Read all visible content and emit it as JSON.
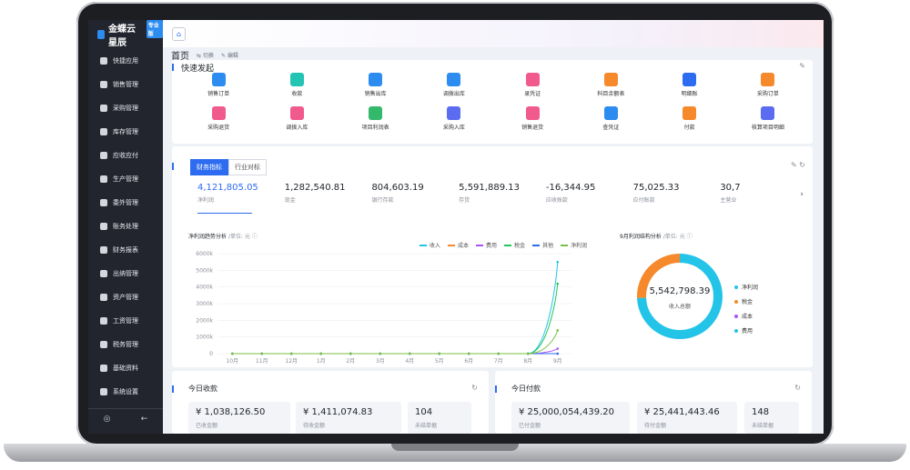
{
  "app": {
    "logo_text": "金蝶云星辰",
    "edition_badge": "专业版"
  },
  "sidebar": {
    "items": [
      {
        "label": "快捷应用",
        "icon": "grid-icon"
      },
      {
        "label": "销售管理",
        "icon": "chart-icon"
      },
      {
        "label": "采购管理",
        "icon": "cart-icon"
      },
      {
        "label": "库存管理",
        "icon": "box-icon"
      },
      {
        "label": "应收应付",
        "icon": "money-icon"
      },
      {
        "label": "生产管理",
        "icon": "factory-icon"
      },
      {
        "label": "委外管理",
        "icon": "outsource-icon"
      },
      {
        "label": "账务处理",
        "icon": "ledger-icon"
      },
      {
        "label": "财务报表",
        "icon": "report-icon"
      },
      {
        "label": "出纳管理",
        "icon": "cashier-icon"
      },
      {
        "label": "资产管理",
        "icon": "asset-icon"
      },
      {
        "label": "工资管理",
        "icon": "salary-icon"
      },
      {
        "label": "税务管理",
        "icon": "tax-icon"
      },
      {
        "label": "基础资料",
        "icon": "data-icon"
      },
      {
        "label": "系统设置",
        "icon": "settings-icon"
      }
    ],
    "footer": {
      "settings_glyph": "◎",
      "collapse_glyph": "←"
    }
  },
  "page": {
    "home_glyph": "⌂",
    "title": "首页",
    "switch_label": "切换",
    "edit_label": "编辑"
  },
  "quick_launch": {
    "title": "快速发起",
    "items": [
      {
        "label": "销售订单",
        "color": "#2d8cf0"
      },
      {
        "label": "收款",
        "color": "#23c4b4"
      },
      {
        "label": "销售出库",
        "color": "#2d8cf0"
      },
      {
        "label": "调拨出库",
        "color": "#2d8cf0"
      },
      {
        "label": "录凭证",
        "color": "#f05a8c"
      },
      {
        "label": "科目余额表",
        "color": "#f5892b"
      },
      {
        "label": "明细账",
        "color": "#2d6cf0"
      },
      {
        "label": "采购订单",
        "color": "#f5892b"
      },
      {
        "label": "采购退货",
        "color": "#f05a8c"
      },
      {
        "label": "调拨入库",
        "color": "#f05a8c"
      },
      {
        "label": "项目利润表",
        "color": "#34b86b"
      },
      {
        "label": "采购入库",
        "color": "#5b6cf0"
      },
      {
        "label": "销售退货",
        "color": "#f05a8c"
      },
      {
        "label": "查凭证",
        "color": "#2d8cf0"
      },
      {
        "label": "付款",
        "color": "#f5892b"
      },
      {
        "label": "核算项目明细",
        "color": "#5b6cf0"
      }
    ]
  },
  "metrics": {
    "tabs": [
      "财务指标",
      "行业对标"
    ],
    "kpis": [
      {
        "value": "4,121,805.05",
        "label": "净利润"
      },
      {
        "value": "1,282,540.81",
        "label": "现金"
      },
      {
        "value": "804,603.19",
        "label": "银行存款"
      },
      {
        "value": "5,591,889.13",
        "label": "存货"
      },
      {
        "value": "-16,344.95",
        "label": "应收账款"
      },
      {
        "value": "75,025.33",
        "label": "应付账款"
      },
      {
        "value": "30,7",
        "label": "主营业"
      }
    ]
  },
  "trend_chart": {
    "title": "净利润趋势分析",
    "unit": "/单位: 元",
    "chart_data": {
      "type": "line",
      "categories": [
        "10月",
        "11月",
        "12月",
        "1月",
        "2月",
        "3月",
        "4月",
        "5月",
        "6月",
        "7月",
        "8月",
        "9月"
      ],
      "ylim": [
        0,
        6000
      ],
      "yticks": [
        "0",
        "1000k",
        "2000k",
        "3000k",
        "4000k",
        "5000k",
        "6000k"
      ],
      "series": [
        {
          "name": "收入",
          "color": "#23c4e8",
          "values": [
            0,
            0,
            0,
            0,
            0,
            0,
            0,
            0,
            0,
            0,
            0,
            5500
          ]
        },
        {
          "name": "成本",
          "color": "#f5892b",
          "values": [
            0,
            0,
            0,
            0,
            0,
            0,
            0,
            0,
            0,
            0,
            0,
            0
          ]
        },
        {
          "name": "费用",
          "color": "#a855f7",
          "values": [
            0,
            0,
            0,
            0,
            0,
            0,
            0,
            0,
            0,
            0,
            0,
            300
          ]
        },
        {
          "name": "税金",
          "color": "#22c55e",
          "values": [
            0,
            0,
            0,
            0,
            0,
            0,
            0,
            0,
            0,
            0,
            0,
            4200
          ]
        },
        {
          "name": "其他",
          "color": "#2d6cf0",
          "values": [
            0,
            0,
            0,
            0,
            0,
            0,
            0,
            0,
            0,
            0,
            0,
            0
          ]
        },
        {
          "name": "净利润",
          "color": "#7bc043",
          "values": [
            0,
            0,
            0,
            0,
            0,
            0,
            0,
            0,
            0,
            0,
            0,
            1400
          ]
        }
      ]
    }
  },
  "profit_structure": {
    "title": "9月利润结构分析",
    "unit": "/单位: 元",
    "total_value": "5,542,798.39",
    "total_label": "收入总额",
    "chart_data": {
      "type": "pie",
      "categories": [
        "净利润",
        "税金",
        "成本",
        "费用"
      ],
      "values": [
        4121805.05,
        1420993.34,
        0,
        0
      ],
      "colors": [
        "#23c4e8",
        "#f5892b",
        "#a855f7",
        "#23c4e8"
      ]
    }
  },
  "today_receipts": {
    "title": "今日收款",
    "refresh_glyph": "↻",
    "tiles": [
      {
        "value": "¥ 1,038,126.50",
        "label": "已收金额"
      },
      {
        "value": "¥ 1,411,074.83",
        "label": "待收金额"
      },
      {
        "value": "104",
        "label": "未结单据"
      }
    ]
  },
  "today_payments": {
    "title": "今日付款",
    "refresh_glyph": "↻",
    "tiles": [
      {
        "value": "¥ 25,000,054,439.20",
        "label": "已付金额"
      },
      {
        "value": "¥ 25,441,443.46",
        "label": "待付金额"
      },
      {
        "value": "148",
        "label": "未结单据"
      }
    ]
  }
}
